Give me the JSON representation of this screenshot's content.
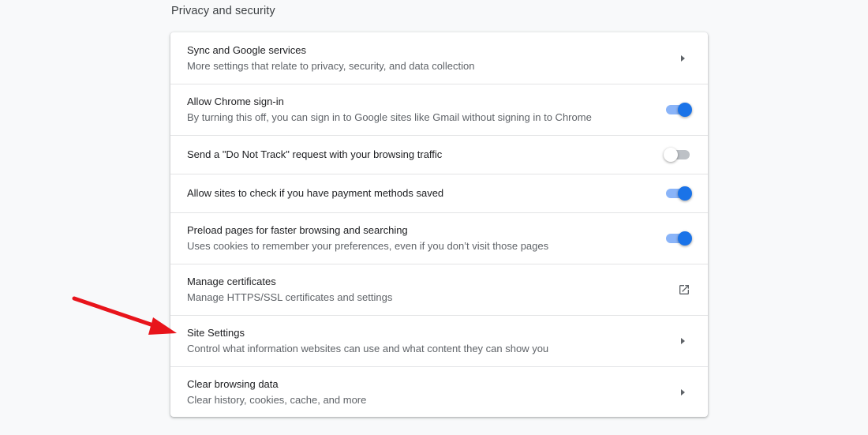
{
  "section": {
    "title": "Privacy and security"
  },
  "rows": [
    {
      "label": "Sync and Google services",
      "sublabel": "More settings that relate to privacy, security, and data collection",
      "control": "arrow"
    },
    {
      "label": "Allow Chrome sign-in",
      "sublabel": "By turning this off, you can sign in to Google sites like Gmail without signing in to Chrome",
      "control": "toggle",
      "checked": true
    },
    {
      "label": "Send a \"Do Not Track\" request with your browsing traffic",
      "control": "toggle",
      "checked": false
    },
    {
      "label": "Allow sites to check if you have payment methods saved",
      "control": "toggle",
      "checked": true
    },
    {
      "label": "Preload pages for faster browsing and searching",
      "sublabel": "Uses cookies to remember your preferences, even if you don’t visit those pages",
      "control": "toggle",
      "checked": true
    },
    {
      "label": "Manage certificates",
      "sublabel": "Manage HTTPS/SSL certificates and settings",
      "control": "external-link"
    },
    {
      "label": "Site Settings",
      "sublabel": "Control what information websites can use and what content they can show you",
      "control": "arrow"
    },
    {
      "label": "Clear browsing data",
      "sublabel": "Clear history, cookies, cache, and more",
      "control": "arrow"
    }
  ],
  "icons": {
    "arrow": "arrow-right-icon",
    "external": "open-in-new-icon",
    "annotation": "red-arrow-annotation"
  },
  "colors": {
    "accent": "#1a73e8",
    "accent_track": "#8ab4f8",
    "off_track": "#bdc1c6",
    "annotation": "#e8141b"
  }
}
